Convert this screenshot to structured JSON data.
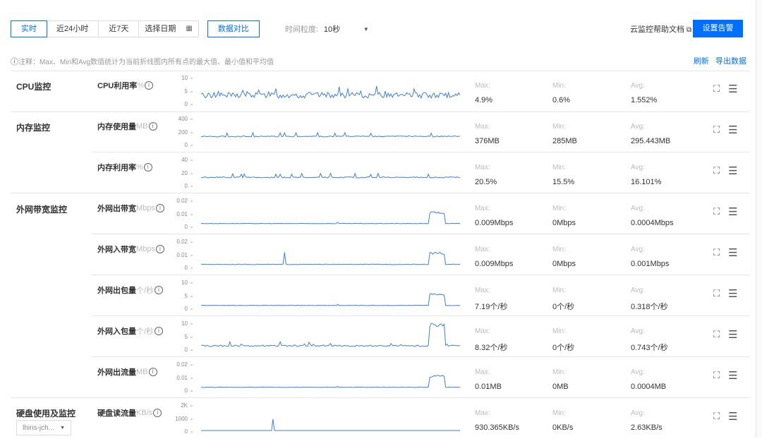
{
  "toolbar": {
    "time_tabs": [
      "实时",
      "近24小时",
      "近7天"
    ],
    "date_picker": "选择日期",
    "compare": "数据对比",
    "granularity_label": "时间粒度:",
    "granularity_value": "10秒",
    "doc_link": "云监控帮助文档",
    "alarm_button": "设置告警"
  },
  "note": "注释：Max、Min和Avg数值统计为当前折线图内所有点的最大值、最小值和平均值",
  "actions": {
    "refresh": "刷新",
    "export": "导出数据"
  },
  "stat_labels": {
    "max": "Max:",
    "min": "Min:",
    "avg": "Avg:"
  },
  "groups": [
    {
      "label": "CPU监控"
    },
    {
      "label": "内存监控"
    },
    {
      "label": "外网带宽监控"
    },
    {
      "label": "硬盘使用及监控",
      "select": "lhins-jch..."
    }
  ],
  "metrics": [
    {
      "name": "CPU利用率",
      "unit": "%",
      "ticks": [
        "10",
        "5",
        "0"
      ],
      "max": "4.9%",
      "min": "0.6%",
      "avg": "1.552%"
    },
    {
      "name": "内存使用量",
      "unit": "MB",
      "ticks": [
        "400",
        "200",
        "0"
      ],
      "max": "376MB",
      "min": "285MB",
      "avg": "295.443MB"
    },
    {
      "name": "内存利用率",
      "unit": "%",
      "ticks": [
        "40",
        "20",
        "0"
      ],
      "max": "20.5%",
      "min": "15.5%",
      "avg": "16.101%"
    },
    {
      "name": "外网出带宽",
      "unit": "Mbps",
      "ticks": [
        "0.02",
        "0.01",
        "0"
      ],
      "max": "0.009Mbps",
      "min": "0Mbps",
      "avg": "0.0004Mbps"
    },
    {
      "name": "外网入带宽",
      "unit": "Mbps",
      "ticks": [
        "0.02",
        "0.01",
        "0"
      ],
      "max": "0.009Mbps",
      "min": "0Mbps",
      "avg": "0.001Mbps"
    },
    {
      "name": "外网出包量",
      "unit": "个/秒",
      "ticks": [
        "10",
        "5",
        "0"
      ],
      "max": "7.19个/秒",
      "min": "0个/秒",
      "avg": "0.318个/秒"
    },
    {
      "name": "外网入包量",
      "unit": "个/秒",
      "ticks": [
        "10",
        "5",
        "0"
      ],
      "max": "8.32个/秒",
      "min": "0个/秒",
      "avg": "0.743个/秒"
    },
    {
      "name": "外网出流量",
      "unit": "MB",
      "ticks": [
        "0.02",
        "0.01",
        "0"
      ],
      "max": "0.01MB",
      "min": "0MB",
      "avg": "0.0004MB"
    },
    {
      "name": "硬盘读流量",
      "unit": "KB/s",
      "ticks": [
        "2K",
        "1000",
        "0"
      ],
      "max": "930.365KB/s",
      "min": "0KB/s",
      "avg": "2.63KB/s"
    }
  ],
  "colors": {
    "accent": "#006eff",
    "line": "#3d7fd9"
  }
}
